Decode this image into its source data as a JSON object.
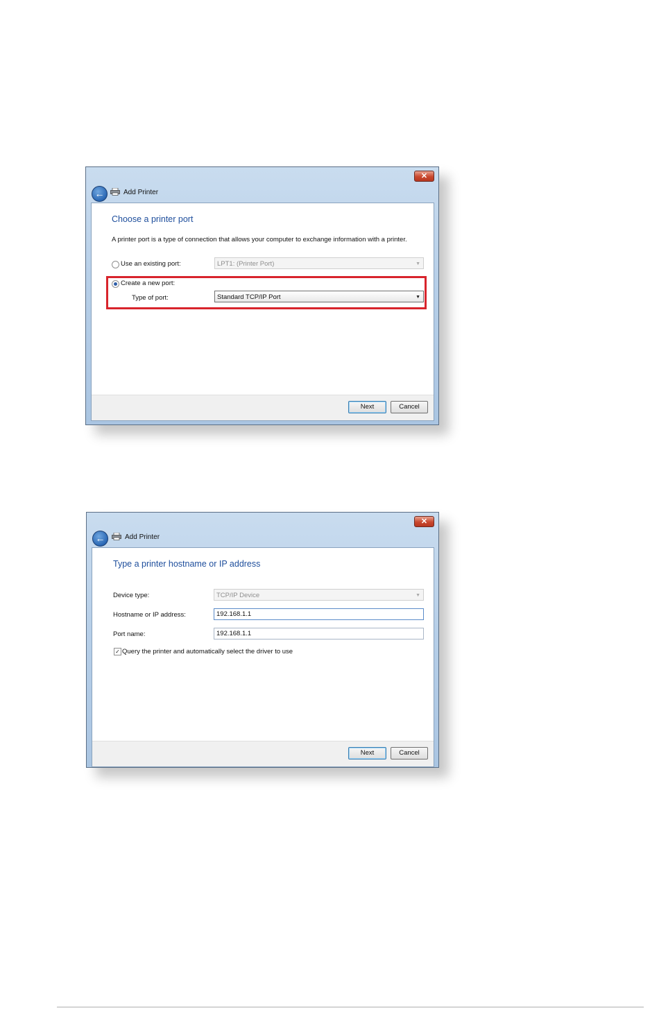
{
  "dialog1": {
    "title": "Add Printer",
    "close_glyph": "✕",
    "back_glyph": "←",
    "heading": "Choose a printer port",
    "description": "A printer port is a type of connection that allows your computer to exchange information with a printer.",
    "use_existing_label": "Use an existing port:",
    "existing_port_value": "LPT1: (Printer Port)",
    "create_new_label": "Create a new port:",
    "type_of_port_label": "Type of port:",
    "type_of_port_value": "Standard TCP/IP Port",
    "selected_option": "create_new",
    "next_label": "Next",
    "cancel_label": "Cancel",
    "highlight_color": "#d8242c"
  },
  "dialog2": {
    "title": "Add Printer",
    "close_glyph": "✕",
    "back_glyph": "←",
    "heading": "Type a printer hostname or IP address",
    "device_type_label": "Device type:",
    "device_type_value": "TCP/IP Device",
    "hostname_label": "Hostname or IP address:",
    "hostname_value": "192.168.1.1",
    "port_name_label": "Port name:",
    "port_name_value": "192.168.1.1",
    "query_label": "Query the printer and automatically select the driver to use",
    "query_checked": true,
    "check_glyph": "✓",
    "next_label": "Next",
    "cancel_label": "Cancel"
  },
  "icons": {
    "back": "back-arrow-icon",
    "printer": "printer-icon",
    "close": "close-icon",
    "dropdown": "chevron-down-icon"
  },
  "arrow_glyph": "▼"
}
